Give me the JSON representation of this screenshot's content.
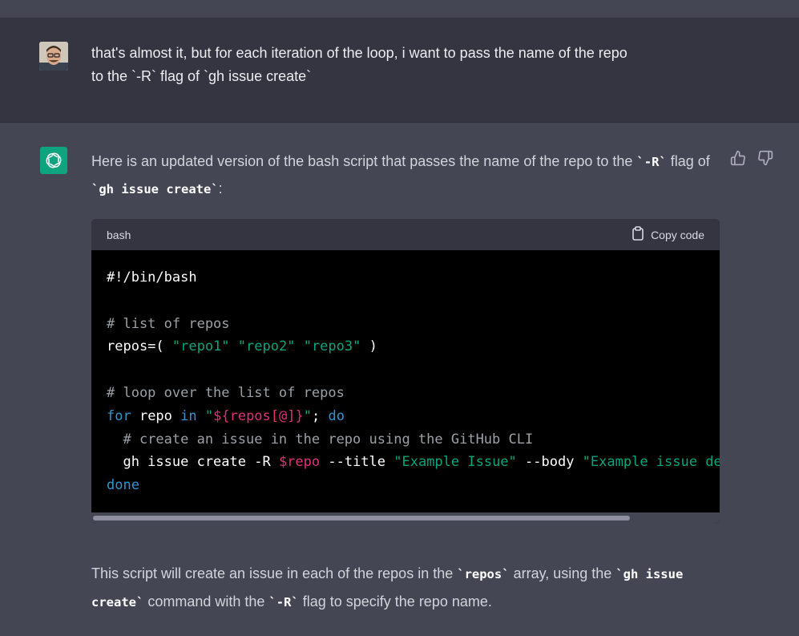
{
  "user_message": {
    "text_line1": "that's almost it, but for each iteration of the loop, i want to pass the name of the repo",
    "text_line2": "to the `-R` flag of `gh issue create`"
  },
  "assistant_message": {
    "intro_before": "Here is an updated version of the bash script that passes the name of the repo to the ",
    "intro_code1": "`-R`",
    "intro_mid": " flag of ",
    "intro_code2": "`gh issue create`",
    "intro_after": ":",
    "code_block": {
      "language": "bash",
      "copy_label": "Copy code",
      "lines": {
        "l1": "#!/bin/bash",
        "l3": "# list of repos",
        "l4_a": "repos=( ",
        "l4_s1": "\"repo1\"",
        "l4_s2": "\"repo2\"",
        "l4_s3": "\"repo3\"",
        "l4_end": " )",
        "l6": "# loop over the list of repos",
        "l7_for": "for",
        "l7_repo": " repo ",
        "l7_in": "in",
        "l7_q1": "\"",
        "l7_var": "${repos[@]}",
        "l7_q2": "\"",
        "l7_semi": "; ",
        "l7_do": "do",
        "l8": "  # create an issue in the repo using the GitHub CLI",
        "l9_a": "  gh issue create -R ",
        "l9_var": "$repo",
        "l9_b": " --title ",
        "l9_s1": "\"Example Issue\"",
        "l9_c": " --body ",
        "l9_s2": "\"Example issue des",
        "l10": "done"
      }
    },
    "outro_before": "This script will create an issue in each of the repos in the ",
    "outro_code1": "`repos`",
    "outro_mid": " array, using the ",
    "outro_code2": "`gh issue create`",
    "outro_mid2": " command with the ",
    "outro_code3": "`-R`",
    "outro_after": " flag to specify the repo name."
  },
  "colors": {
    "user_bg": "#343541",
    "assistant_bg": "#444654",
    "gpt_green": "#10a37f",
    "code_string": "#00a67d",
    "code_keyword": "#2e95d3",
    "code_variable": "#df3079"
  },
  "icons": [
    "user-avatar",
    "openai-logo-icon",
    "thumbs-up-icon",
    "thumbs-down-icon",
    "clipboard-icon"
  ]
}
